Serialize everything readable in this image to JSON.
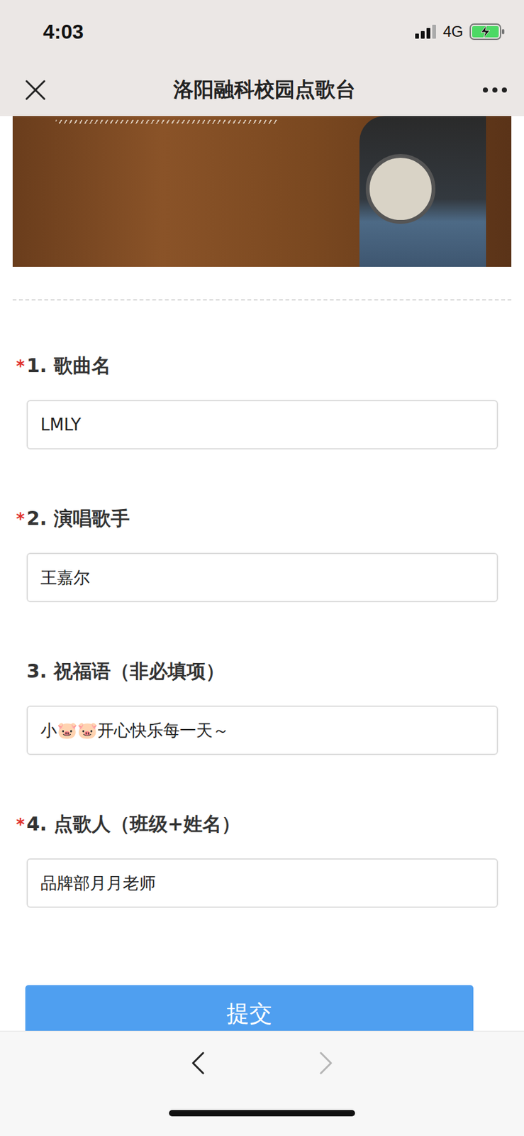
{
  "status_bar": {
    "time": "4:03",
    "network": "4G",
    "battery_charging": true
  },
  "nav": {
    "title": "洛阳融科校园点歌台"
  },
  "form": {
    "required_mark": "*",
    "fields": [
      {
        "label": "1. 歌曲名",
        "required": true,
        "value": "LMLY"
      },
      {
        "label": "2. 演唱歌手",
        "required": true,
        "value": "王嘉尔"
      },
      {
        "label": "3. 祝福语（非必填项）",
        "required": false,
        "value": "小🐷🐷开心快乐每一天～"
      },
      {
        "label": "4. 点歌人（班级+姓名）",
        "required": true,
        "value": "品牌部月月老师"
      }
    ],
    "submit": "提交"
  },
  "toolbar": {
    "back": {
      "disabled": false
    },
    "forward": {
      "disabled": true
    }
  }
}
